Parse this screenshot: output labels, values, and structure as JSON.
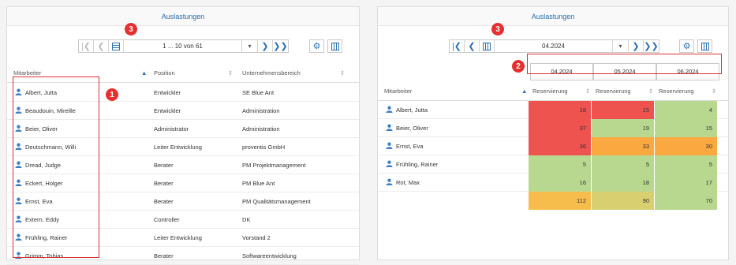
{
  "left": {
    "title": "Auslastungen",
    "pager_info": "1 ... 10 von 61",
    "headers": [
      "Mitarbeiter",
      "Position",
      "Unternehmensbereich"
    ],
    "rows": [
      {
        "name": "Albert, Jutta",
        "position": "Entwickler",
        "unit": "SE Blue Ant"
      },
      {
        "name": "Beaudouin, Mireille",
        "position": "Entwickler",
        "unit": "Administration"
      },
      {
        "name": "Beier, Oliver",
        "position": "Administrator",
        "unit": "Administration"
      },
      {
        "name": "Deutschmann, Willi",
        "position": "Leiter Entwicklung",
        "unit": "proventis GmbH"
      },
      {
        "name": "Dread, Judge",
        "position": "Berater",
        "unit": "PM Projektmanagement"
      },
      {
        "name": "Eckert, Holger",
        "position": "Berater",
        "unit": "PM Blue Ant"
      },
      {
        "name": "Ernst, Eva",
        "position": "Berater",
        "unit": "PM Qualitätsmanagement"
      },
      {
        "name": "Extern, Eddy",
        "position": "Controller",
        "unit": "DK"
      },
      {
        "name": "Frühling, Rainer",
        "position": "Leiter Entwicklung",
        "unit": "Vorstand 2"
      },
      {
        "name": "Grimm, Tobias",
        "position": "Berater",
        "unit": "Softwareentwicklung"
      }
    ]
  },
  "right": {
    "title": "Auslastungen",
    "pager_info": "04.2024",
    "months": [
      "04.2024",
      "05.2024",
      "06.2024"
    ],
    "header_name": "Mitarbeiter",
    "header_col": "Reservierung",
    "rows": [
      {
        "name": "Albert, Jutta",
        "values": [
          "18",
          "15",
          "4"
        ]
      },
      {
        "name": "Beier, Oliver",
        "values": [
          "37",
          "19",
          "15"
        ]
      },
      {
        "name": "Ernst, Eva",
        "values": [
          "36",
          "33",
          "30"
        ]
      },
      {
        "name": "Frühling, Rainer",
        "values": [
          "5",
          "5",
          "5"
        ]
      },
      {
        "name": "Rot, Max",
        "values": [
          "16",
          "18",
          "17"
        ]
      }
    ],
    "totals": [
      "112",
      "90",
      "70"
    ]
  },
  "badges": [
    "1",
    "2",
    "3",
    "3"
  ],
  "colors": {
    "red": "#ef5350",
    "orange": "#f9a940",
    "light_green": "#b9d88f",
    "green": "#a5cd7e",
    "yellow_orange": "#f6bd4c",
    "yellow_green": "#d8d070",
    "accent": "#2a6fb0"
  }
}
